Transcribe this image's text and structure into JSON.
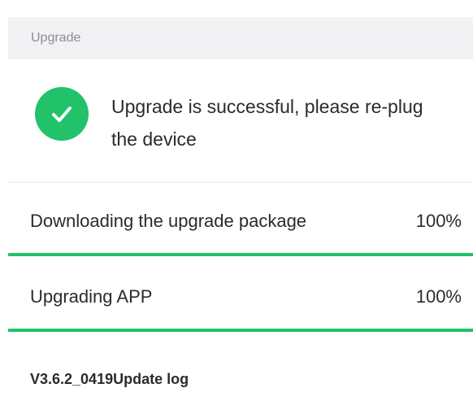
{
  "section": {
    "title": "Upgrade"
  },
  "status": {
    "icon": "checkmark-icon",
    "color": "#22c26a",
    "message": "Upgrade is successful, please re-plug the device"
  },
  "progress": [
    {
      "label": "Downloading the upgrade package",
      "percent_text": "100%",
      "percent": 100
    },
    {
      "label": "Upgrading APP",
      "percent_text": "100%",
      "percent": 100
    }
  ],
  "update_log": {
    "label": "V3.6.2_0419Update log"
  }
}
